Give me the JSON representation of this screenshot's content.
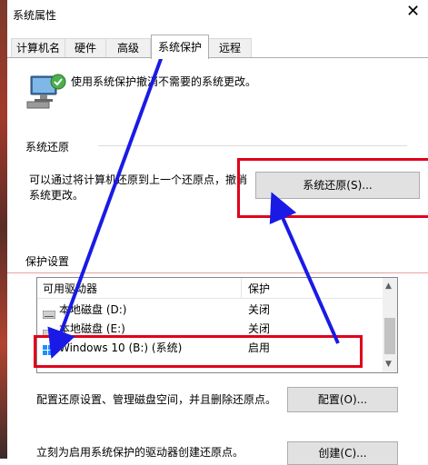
{
  "window": {
    "title": "系统属性",
    "close_glyph": "✕"
  },
  "tabs": [
    {
      "label": "计算机名"
    },
    {
      "label": "硬件"
    },
    {
      "label": "高级"
    },
    {
      "label": "系统保护"
    },
    {
      "label": "远程"
    }
  ],
  "intro": {
    "text": "使用系统保护撤消不需要的系统更改。"
  },
  "restore": {
    "section_title": "系统还原",
    "desc_line1": "可以通过将计算机还原到上一个还原点，撤消",
    "desc_line2": "系统更改。",
    "button_label": "系统还原(S)..."
  },
  "protection": {
    "section_title": "保护设置",
    "columns": [
      "可用驱动器",
      "保护"
    ],
    "drives": [
      {
        "name": "本地磁盘 (D:)",
        "status": "关闭",
        "icon": "hard-drive-icon"
      },
      {
        "name": "本地磁盘 (E:)",
        "status": "关闭",
        "icon": "hard-drive-icon"
      },
      {
        "name": "Windows 10 (B:) (系统)",
        "status": "启用",
        "icon": "windows-drive-icon"
      }
    ],
    "configure_desc": "配置还原设置、管理磁盘空间，并且删除还原点。",
    "configure_button": "配置(O)...",
    "create_desc": "立刻为启用系统保护的驱动器创建还原点。",
    "create_button": "创建(C)..."
  },
  "annotations": {
    "highlight_color": "#e0001b",
    "arrow_color": "#1a1ae6"
  }
}
